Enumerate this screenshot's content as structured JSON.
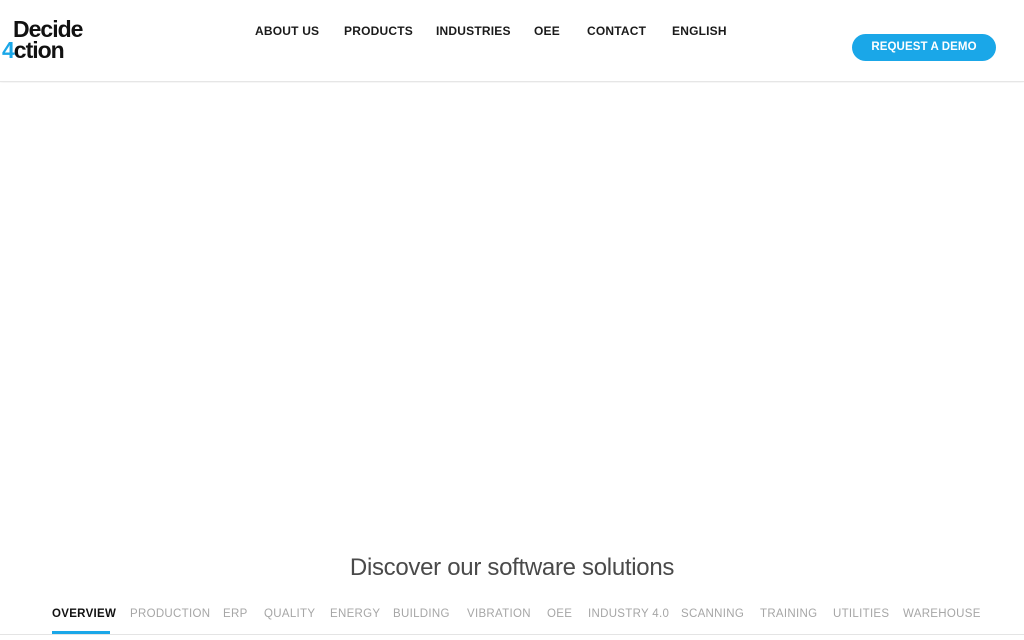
{
  "brand": {
    "logo_line1": "Decide",
    "logo_accent": "4",
    "logo_line2_rest": "ction",
    "accent_color": "#1aa7e8"
  },
  "nav": {
    "items": [
      {
        "label": "ABOUT US"
      },
      {
        "label": "PRODUCTS"
      },
      {
        "label": "INDUSTRIES"
      },
      {
        "label": "OEE"
      },
      {
        "label": "CONTACT"
      },
      {
        "label": "ENGLISH"
      }
    ],
    "cta_label": "REQUEST A DEMO"
  },
  "main": {
    "section_title": "Discover our software solutions",
    "tabs": [
      {
        "label": "OVERVIEW",
        "active": true
      },
      {
        "label": "PRODUCTION"
      },
      {
        "label": "ERP"
      },
      {
        "label": "QUALITY"
      },
      {
        "label": "ENERGY"
      },
      {
        "label": "BUILDING"
      },
      {
        "label": "VIBRATION"
      },
      {
        "label": "OEE"
      },
      {
        "label": "INDUSTRY 4.0"
      },
      {
        "label": "SCANNING"
      },
      {
        "label": "TRAINING"
      },
      {
        "label": "UTILITIES"
      },
      {
        "label": "WAREHOUSE"
      }
    ]
  }
}
